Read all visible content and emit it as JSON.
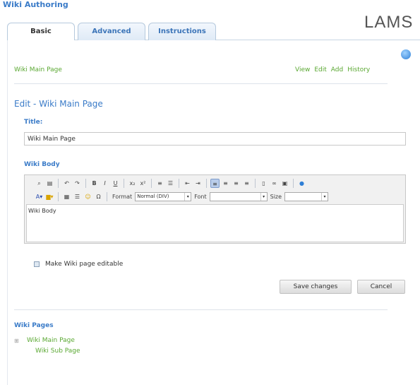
{
  "app": {
    "title": "Wiki Authoring",
    "logo_text": "LAMS"
  },
  "tabs": [
    {
      "label": "Basic",
      "active": true
    },
    {
      "label": "Advanced",
      "active": false
    },
    {
      "label": "Instructions",
      "active": false
    }
  ],
  "breadcrumb": {
    "label": "Wiki Main Page"
  },
  "actions": {
    "view": "View",
    "edit": "Edit",
    "add": "Add",
    "history": "History"
  },
  "edit": {
    "heading": "Edit - Wiki Main Page"
  },
  "title_field": {
    "label": "Title:",
    "value": "Wiki Main Page"
  },
  "body_field": {
    "label": "Wiki Body",
    "content": "Wiki Body",
    "toolbar": {
      "format_label": "Format",
      "format_value": "Normal (DIV)",
      "font_label": "Font",
      "font_value": "",
      "size_label": "Size",
      "size_value": ""
    }
  },
  "editable": {
    "label": "Make Wiki page editable"
  },
  "buttons": {
    "save": "Save changes",
    "cancel": "Cancel"
  },
  "wiki_pages": {
    "heading": "Wiki Pages",
    "expander": "⊞",
    "items": [
      "Wiki Main Page",
      "Wiki Sub Page"
    ]
  },
  "colors": {
    "accent": "#3a7bc8",
    "link": "#5aa832"
  }
}
